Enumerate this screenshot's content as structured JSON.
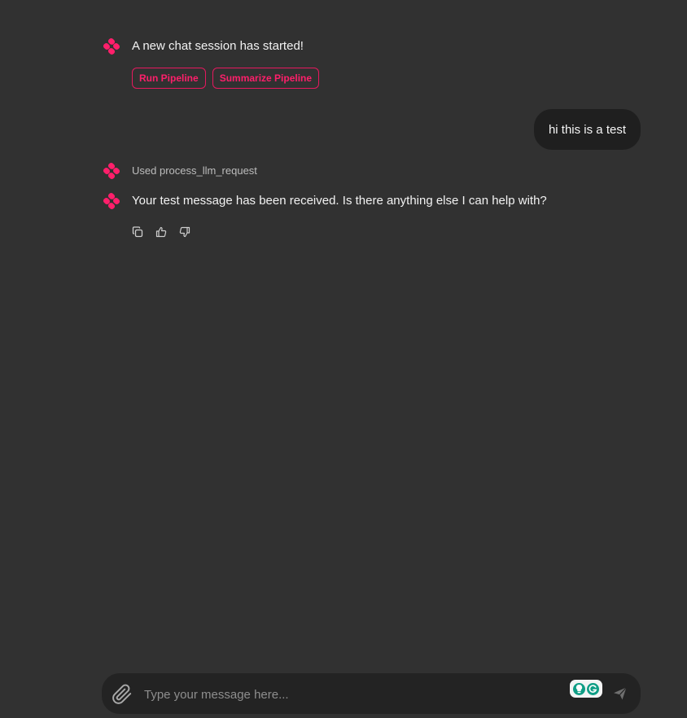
{
  "colors": {
    "background": "#313131",
    "accent": "#ff1f6b",
    "user_bubble": "#1f1f1f",
    "input_bar": "#232323",
    "grammarly_green": "#0f9d85"
  },
  "messages": {
    "welcome": {
      "text": "A new chat session has started!",
      "icon": "app-logo-icon"
    },
    "actions": [
      {
        "label": "Run Pipeline"
      },
      {
        "label": "Summarize Pipeline"
      }
    ],
    "user": {
      "text": "hi this is a test"
    },
    "tool_usage": {
      "text": "Used process_llm_request",
      "icon": "app-logo-icon"
    },
    "reply": {
      "text": "Your test message has been received. Is there anything else I can help with?",
      "icon": "app-logo-icon"
    },
    "feedback_icons": [
      "copy-icon",
      "thumbs-up-icon",
      "thumbs-down-icon"
    ]
  },
  "composer": {
    "placeholder": "Type your message here...",
    "value": "",
    "attach_icon": "paperclip-icon",
    "send_icon": "send-icon",
    "extension_icon": "grammarly-icon"
  }
}
